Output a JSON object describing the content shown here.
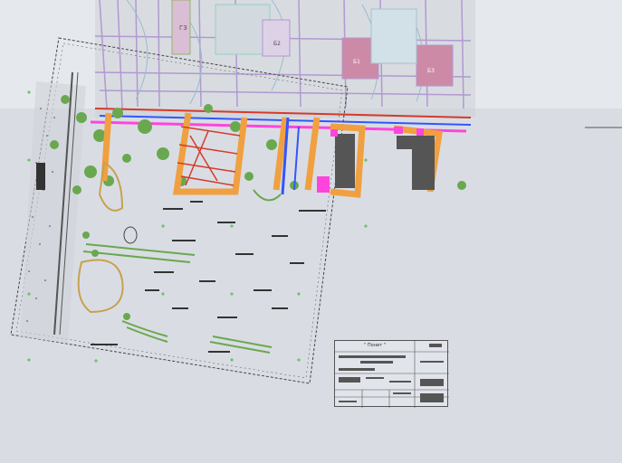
{
  "view": {
    "background": "#d9dde3",
    "upper_band": "#e6e8ec"
  },
  "colors": {
    "orange": "#f0a040",
    "green": "#6aa84f",
    "magenta": "#ff44dd",
    "blue": "#3355ff",
    "purple": "#a88ccc",
    "red": "#d63a2a",
    "dark": "#333333",
    "grid": "#444444"
  },
  "blocks": {
    "g3": "Г3",
    "b_left": "Б2",
    "b_mid": "Б1",
    "b_right": "Б3"
  },
  "stamp": {
    "title": "\" Понит \""
  },
  "icons": [
    "crosshair-icon"
  ]
}
